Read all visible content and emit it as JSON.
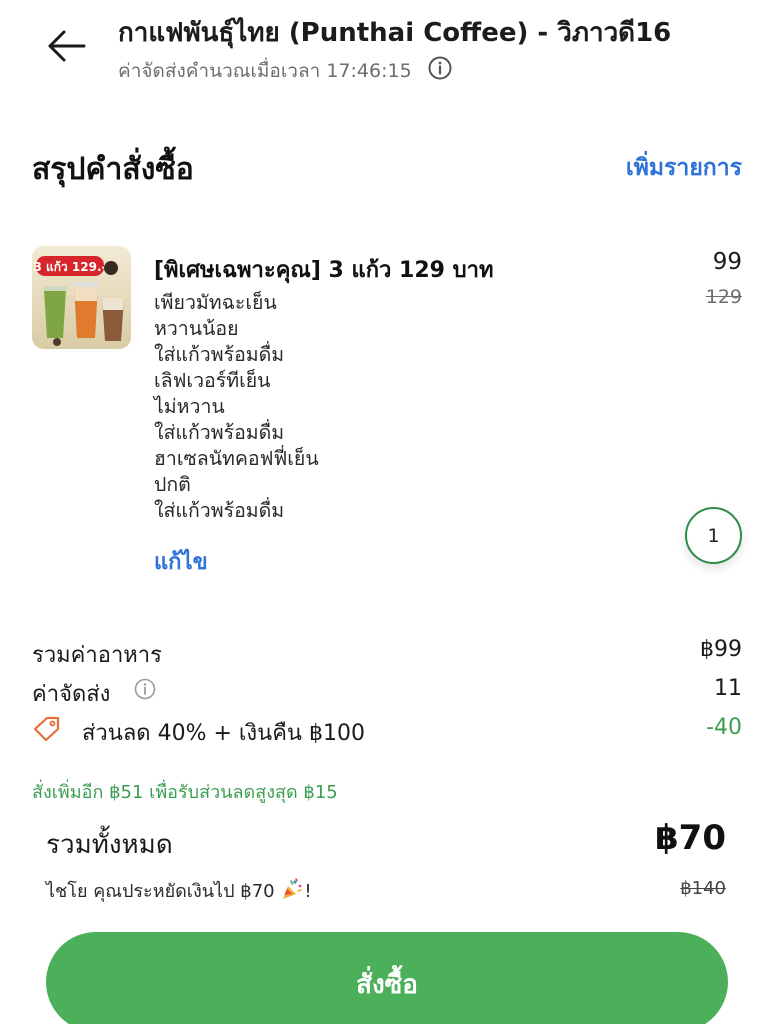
{
  "header": {
    "store_name": "กาแฟพันธุ์ไทย (Punthai Coffee) - วิภาวดี16",
    "fee_note": "ค่าจัดส่งคำนวณเมื่อเวลา 17:46:15"
  },
  "summary": {
    "title": "สรุปคำสั่งซื้อ",
    "add_items_label": "เพิ่มรายการ"
  },
  "item": {
    "title": "[พิเศษเฉพาะคุณ] 3 แก้ว 129 บาท",
    "price": "99",
    "old_price": "129",
    "thumb_badge": "3 แก้ว 129.-",
    "options": [
      "เพียวมัทฉะเย็น",
      "หวานน้อย",
      "ใส่แก้วพร้อมดื่ม",
      "เลิฟเวอร์ทีเย็น",
      "ไม่หวาน",
      "ใส่แก้วพร้อมดื่ม",
      "ฮาเซลนัทคอฟฟี่เย็น",
      "ปกติ",
      "ใส่แก้วพร้อมดื่ม"
    ],
    "edit_label": "แก้ไข",
    "quantity": "1"
  },
  "costs": {
    "food_label": "รวมค่าอาหาร",
    "food_value": "฿99",
    "delivery_label": "ค่าจัดส่ง",
    "delivery_value": "11",
    "discount_label": "ส่วนลด 40% + เงินคืน ฿100",
    "discount_value": "-40",
    "upsell_note": "สั่งเพิ่มอีก ฿51 เพื่อรับส่วนลดสูงสุด ฿15"
  },
  "total": {
    "label": "รวมทั้งหมด",
    "value": "฿70",
    "savings_note": "ไชโย คุณประหยัดเงินไป ฿70",
    "savings_suffix": "!",
    "original_value": "฿140"
  },
  "actions": {
    "order_label": "สั่งซื้อ"
  },
  "colors": {
    "accent_blue": "#2f73d9",
    "accent_green": "#4caf5a",
    "discount_green": "#3c9e52"
  },
  "icons": [
    "arrow-left-icon",
    "info-icon",
    "price-tag-icon",
    "party-popper-icon"
  ]
}
